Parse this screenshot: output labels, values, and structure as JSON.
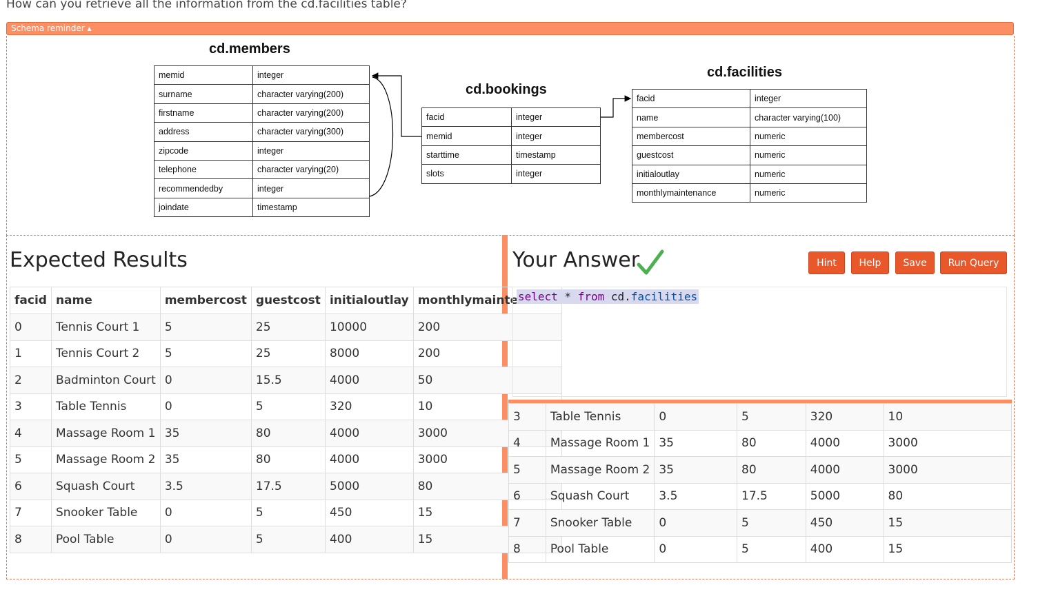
{
  "question": "How can you retrieve all the information from the cd.facilities table?",
  "schema_reminder_label": "Schema reminder ▴",
  "schema": {
    "members": {
      "title": "cd.members",
      "rows": [
        [
          "memid",
          "integer"
        ],
        [
          "surname",
          "character varying(200)"
        ],
        [
          "firstname",
          "character varying(200)"
        ],
        [
          "address",
          "character varying(300)"
        ],
        [
          "zipcode",
          "integer"
        ],
        [
          "telephone",
          "character varying(20)"
        ],
        [
          "recommendedby",
          "integer"
        ],
        [
          "joindate",
          "timestamp"
        ]
      ]
    },
    "bookings": {
      "title": "cd.bookings",
      "rows": [
        [
          "facid",
          "integer"
        ],
        [
          "memid",
          "integer"
        ],
        [
          "starttime",
          "timestamp"
        ],
        [
          "slots",
          "integer"
        ]
      ]
    },
    "facilities": {
      "title": "cd.facilities",
      "rows": [
        [
          "facid",
          "integer"
        ],
        [
          "name",
          "character varying(100)"
        ],
        [
          "membercost",
          "numeric"
        ],
        [
          "guestcost",
          "numeric"
        ],
        [
          "initialoutlay",
          "numeric"
        ],
        [
          "monthlymaintenance",
          "numeric"
        ]
      ]
    }
  },
  "expected": {
    "title": "Expected Results",
    "headers": [
      "facid",
      "name",
      "membercost",
      "guestcost",
      "initialoutlay",
      "monthlymaintenance"
    ],
    "rows": [
      [
        "0",
        "Tennis Court 1",
        "5",
        "25",
        "10000",
        "200"
      ],
      [
        "1",
        "Tennis Court 2",
        "5",
        "25",
        "8000",
        "200"
      ],
      [
        "2",
        "Badminton Court",
        "0",
        "15.5",
        "4000",
        "50"
      ],
      [
        "3",
        "Table Tennis",
        "0",
        "5",
        "320",
        "10"
      ],
      [
        "4",
        "Massage Room 1",
        "35",
        "80",
        "4000",
        "3000"
      ],
      [
        "5",
        "Massage Room 2",
        "35",
        "80",
        "4000",
        "3000"
      ],
      [
        "6",
        "Squash Court",
        "3.5",
        "17.5",
        "5000",
        "80"
      ],
      [
        "7",
        "Snooker Table",
        "0",
        "5",
        "450",
        "15"
      ],
      [
        "8",
        "Pool Table",
        "0",
        "5",
        "400",
        "15"
      ]
    ]
  },
  "answer": {
    "title": "Your Answer",
    "buttons": {
      "hint": "Hint",
      "help": "Help",
      "save": "Save",
      "run": "Run Query"
    },
    "query": {
      "kw1": "select",
      "star": " * ",
      "kw2": "from",
      "schema": " cd.",
      "table": "facilities"
    },
    "rows": [
      [
        "3",
        "Table Tennis",
        "0",
        "5",
        "320",
        "10"
      ],
      [
        "4",
        "Massage Room 1",
        "35",
        "80",
        "4000",
        "3000"
      ],
      [
        "5",
        "Massage Room 2",
        "35",
        "80",
        "4000",
        "3000"
      ],
      [
        "6",
        "Squash Court",
        "3.5",
        "17.5",
        "5000",
        "80"
      ],
      [
        "7",
        "Snooker Table",
        "0",
        "5",
        "450",
        "15"
      ],
      [
        "8",
        "Pool Table",
        "0",
        "5",
        "400",
        "15"
      ]
    ]
  },
  "colors": {
    "accent": "#fb8f63",
    "button": "#e8582b",
    "check": "#4caf50"
  }
}
